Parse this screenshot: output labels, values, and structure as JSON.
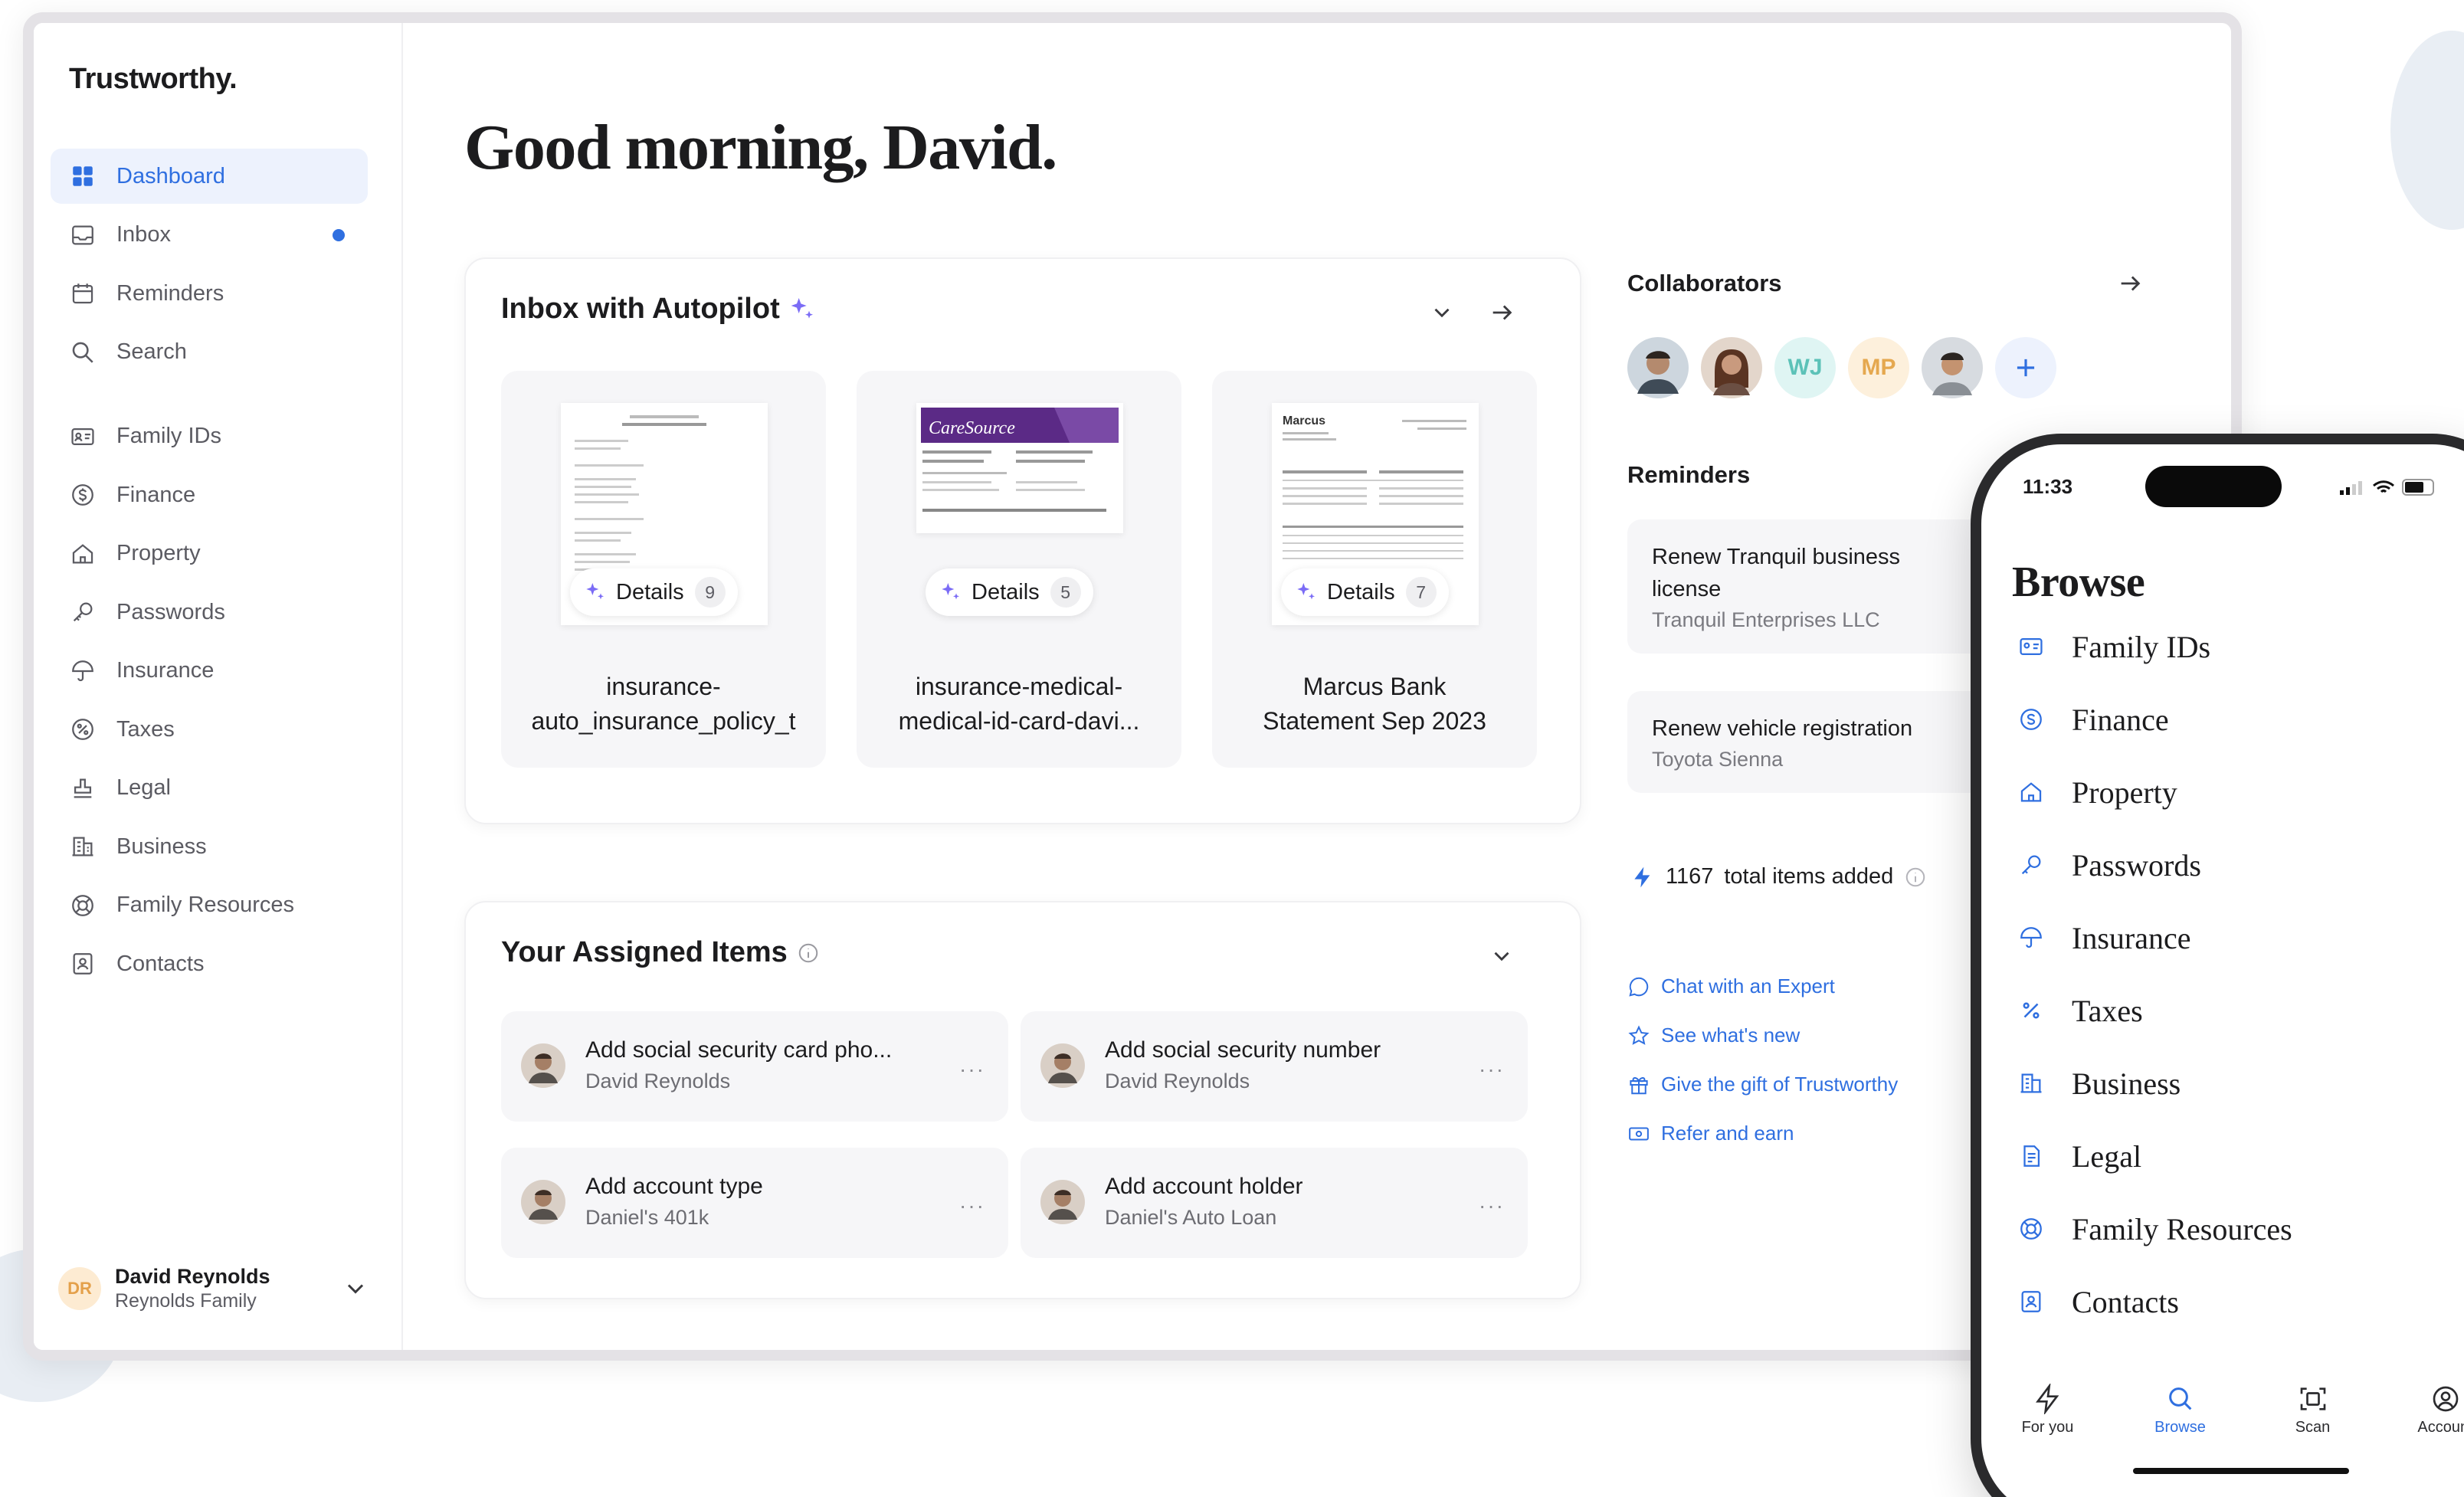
{
  "app": {
    "brand": "Trustworthy."
  },
  "sidebar": {
    "items": [
      {
        "label": "Dashboard",
        "icon": "grid-icon",
        "active": true
      },
      {
        "label": "Inbox",
        "icon": "inbox-icon",
        "unread": true
      },
      {
        "label": "Reminders",
        "icon": "calendar-icon"
      },
      {
        "label": "Search",
        "icon": "search-icon"
      },
      {
        "label": "Family IDs",
        "icon": "id-card-icon"
      },
      {
        "label": "Finance",
        "icon": "dollar-icon"
      },
      {
        "label": "Property",
        "icon": "house-icon"
      },
      {
        "label": "Passwords",
        "icon": "key-icon"
      },
      {
        "label": "Insurance",
        "icon": "umbrella-icon"
      },
      {
        "label": "Taxes",
        "icon": "percent-icon"
      },
      {
        "label": "Legal",
        "icon": "stamp-icon"
      },
      {
        "label": "Business",
        "icon": "building-icon"
      },
      {
        "label": "Family Resources",
        "icon": "lifebuoy-icon"
      },
      {
        "label": "Contacts",
        "icon": "contact-book-icon"
      }
    ],
    "profile": {
      "initials": "DR",
      "name": "David Reynolds",
      "family": "Reynolds Family"
    }
  },
  "main": {
    "greeting": "Good morning, David.",
    "inbox": {
      "title": "Inbox with Autopilot",
      "documents": [
        {
          "name_line1": "insurance-",
          "name_line2": "auto_insurance_policy_t",
          "details_label": "Details",
          "count": "9"
        },
        {
          "name_line1": "insurance-medical-",
          "name_line2": "medical-id-card-davi...",
          "details_label": "Details",
          "count": "5"
        },
        {
          "name_line1": "Marcus Bank",
          "name_line2": "Statement Sep 2023",
          "details_label": "Details",
          "count": "7"
        }
      ],
      "thumbnail_text": {
        "caresource": "CareSource",
        "marcus": "Marcus"
      }
    },
    "assigned": {
      "title": "Your Assigned Items",
      "items": [
        {
          "title": "Add social security card pho...",
          "subtitle": "David Reynolds"
        },
        {
          "title": "Add social security number",
          "subtitle": "David Reynolds"
        },
        {
          "title": "Add account type",
          "subtitle": "Daniel's 401k"
        },
        {
          "title": "Add account holder",
          "subtitle": "Daniel's Auto Loan"
        }
      ],
      "more_label": "···"
    }
  },
  "right": {
    "collaborators_title": "Collaborators",
    "collaborators": [
      {
        "type": "photo"
      },
      {
        "type": "photo"
      },
      {
        "initials": "WJ",
        "bg": "#dff5f3",
        "fg": "#5cc2b8"
      },
      {
        "initials": "MP",
        "bg": "#fdf0dc",
        "fg": "#e5a84f"
      },
      {
        "type": "photo"
      }
    ],
    "reminders_title": "Reminders",
    "reminders": [
      {
        "title": "Renew Tranquil business license",
        "subtitle": "Tranquil Enterprises LLC"
      },
      {
        "title": "Renew vehicle registration",
        "subtitle": "Toyota Sienna"
      }
    ],
    "total_count": "1167",
    "total_label": "total items added",
    "links": [
      {
        "label": "Chat with an Expert",
        "icon": "chat-bubble-icon"
      },
      {
        "label": "See what's new",
        "icon": "star-icon"
      },
      {
        "label": "Give the gift of Trustworthy",
        "icon": "gift-icon"
      },
      {
        "label": "Refer and earn",
        "icon": "ticket-icon"
      }
    ]
  },
  "phone": {
    "time": "11:33",
    "title": "Browse",
    "items": [
      {
        "label": "Family IDs",
        "icon": "id-card-icon"
      },
      {
        "label": "Finance",
        "icon": "dollar-icon"
      },
      {
        "label": "Property",
        "icon": "house-icon"
      },
      {
        "label": "Passwords",
        "icon": "key-icon"
      },
      {
        "label": "Insurance",
        "icon": "umbrella-icon"
      },
      {
        "label": "Taxes",
        "icon": "percent-icon"
      },
      {
        "label": "Business",
        "icon": "building-icon"
      },
      {
        "label": "Legal",
        "icon": "document-icon"
      },
      {
        "label": "Family Resources",
        "icon": "lifebuoy-icon"
      },
      {
        "label": "Contacts",
        "icon": "contact-book-icon"
      }
    ],
    "tabs": [
      {
        "label": "For you",
        "icon": "bolt-icon"
      },
      {
        "label": "Browse",
        "icon": "search-icon",
        "active": true
      },
      {
        "label": "Scan",
        "icon": "scan-icon"
      },
      {
        "label": "Account",
        "icon": "person-circle-icon"
      }
    ]
  },
  "colors": {
    "accent": "#2f6fe0",
    "sparkle": "#7b6cf6",
    "caresource": "#5b2a86"
  }
}
